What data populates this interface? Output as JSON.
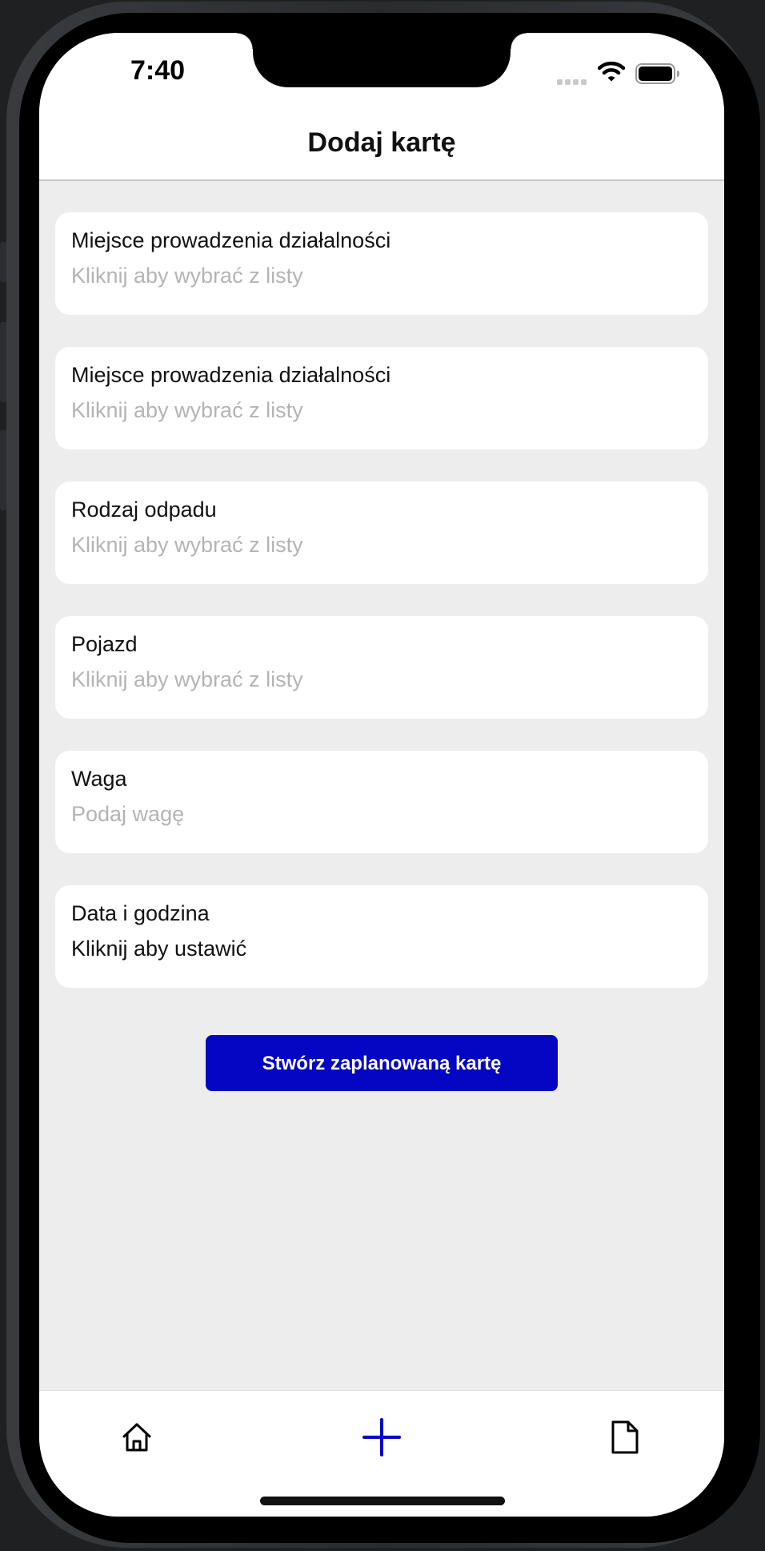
{
  "status_bar": {
    "time": "7:40"
  },
  "header": {
    "title": "Dodaj kartę"
  },
  "form": {
    "fields": [
      {
        "label": "Miejsce prowadzenia działalności",
        "value": "Kliknij aby wybrać z listy"
      },
      {
        "label": "Miejsce prowadzenia działalności",
        "value": "Kliknij aby wybrać z listy"
      },
      {
        "label": "Rodzaj odpadu",
        "value": "Kliknij aby wybrać z listy"
      },
      {
        "label": "Pojazd",
        "value": "Kliknij aby wybrać z listy"
      },
      {
        "label": "Waga",
        "value": "Podaj wagę"
      },
      {
        "label": "Data i godzina",
        "value": "Kliknij aby ustawić"
      }
    ],
    "submit_label": "Stwórz zaplanowaną kartę"
  },
  "tab_bar": {
    "tabs": [
      {
        "icon": "home-icon"
      },
      {
        "icon": "plus-icon"
      },
      {
        "icon": "document-icon"
      }
    ]
  },
  "colors": {
    "accent": "#0505C4",
    "background": "#EDEDED",
    "placeholder": "#B4B4B6"
  }
}
